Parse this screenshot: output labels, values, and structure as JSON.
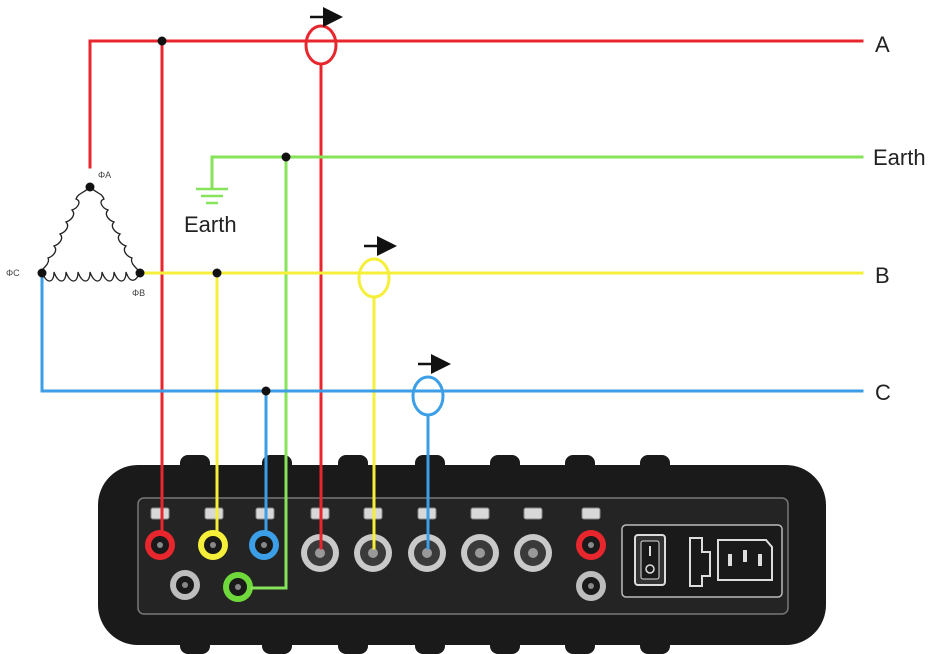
{
  "lines": {
    "a": {
      "label": "A",
      "color": "#e8262d"
    },
    "earth": {
      "label": "Earth",
      "color": "#86e35a"
    },
    "b": {
      "label": "B",
      "color": "#f5ef3a"
    },
    "c": {
      "label": "C",
      "color": "#3b9ee6"
    }
  },
  "ground_symbol": {
    "label": "Earth",
    "icon": "ground-icon"
  },
  "source": {
    "type": "delta winding",
    "node_labels": {
      "a": "ΦA",
      "b": "ΦB",
      "c": "ΦC"
    }
  },
  "current_clamps": [
    {
      "phase": "A",
      "icon": "current-arrow-icon"
    },
    {
      "phase": "B",
      "icon": "current-arrow-icon"
    },
    {
      "phase": "C",
      "icon": "current-arrow-icon"
    }
  ],
  "instrument": {
    "device_color": "#1a1a1a",
    "voltage_inputs": [
      "red",
      "yellow",
      "blue",
      "green"
    ],
    "current_inputs": 5,
    "icons": [
      "power-switch-icon",
      "power-socket-icon"
    ]
  }
}
